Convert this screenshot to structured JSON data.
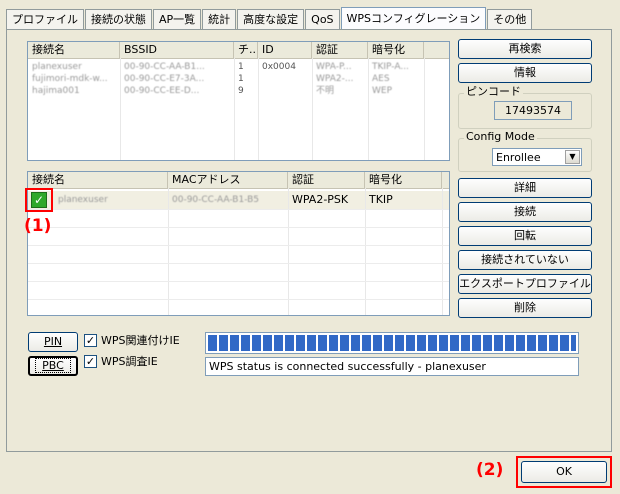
{
  "tabs": [
    "プロファイル",
    "接続の状態",
    "AP一覧",
    "統計",
    "高度な設定",
    "QoS",
    "WPSコンフィグレーション",
    "その他"
  ],
  "active_tab": "WPSコンフィグレーション",
  "ap_list": {
    "columns": [
      "接続名",
      "BSSID",
      "チ...",
      "ID",
      "認証",
      "暗号化"
    ],
    "rows": [
      [
        "planexuser",
        "00-90-CC-AA-B1...",
        "1",
        "0x0004",
        "WPA-P...",
        "TKIP-A..."
      ],
      [
        "fujimori-mdk-w...",
        "00-90-CC-E7-3A...",
        "1",
        "",
        "WPA2-...",
        "AES"
      ],
      [
        "hajima001",
        "00-90-CC-EE-D...",
        "9",
        "",
        "不明",
        "WEP"
      ]
    ]
  },
  "right_buttons": {
    "rescan": "再検索",
    "info": "情報"
  },
  "pin_group": {
    "label": "ピンコード",
    "value": "17493574"
  },
  "config_mode": {
    "label": "Config Mode",
    "selected": "Enrollee"
  },
  "profile_list": {
    "columns": [
      "接続名",
      "MACアドレス",
      "認証",
      "暗号化"
    ],
    "rows": [
      [
        "planexuser",
        "00-90-CC-AA-B1-B5",
        "WPA2-PSK",
        "TKIP"
      ]
    ]
  },
  "profile_buttons": [
    "詳細",
    "接続",
    "回転",
    "接続されていない",
    "エクスポートプロファイル",
    "削除"
  ],
  "annotations": {
    "one": "(1)",
    "two": "(2)"
  },
  "wps": {
    "pin_button": "PIN",
    "pbc_button": "PBC",
    "associate_ie_label": "WPS関連付けIE",
    "probe_ie_label": "WPS調査IE",
    "progress": 1.0,
    "status": "WPS status is connected successfully - planexuser"
  },
  "ok_button": "OK"
}
